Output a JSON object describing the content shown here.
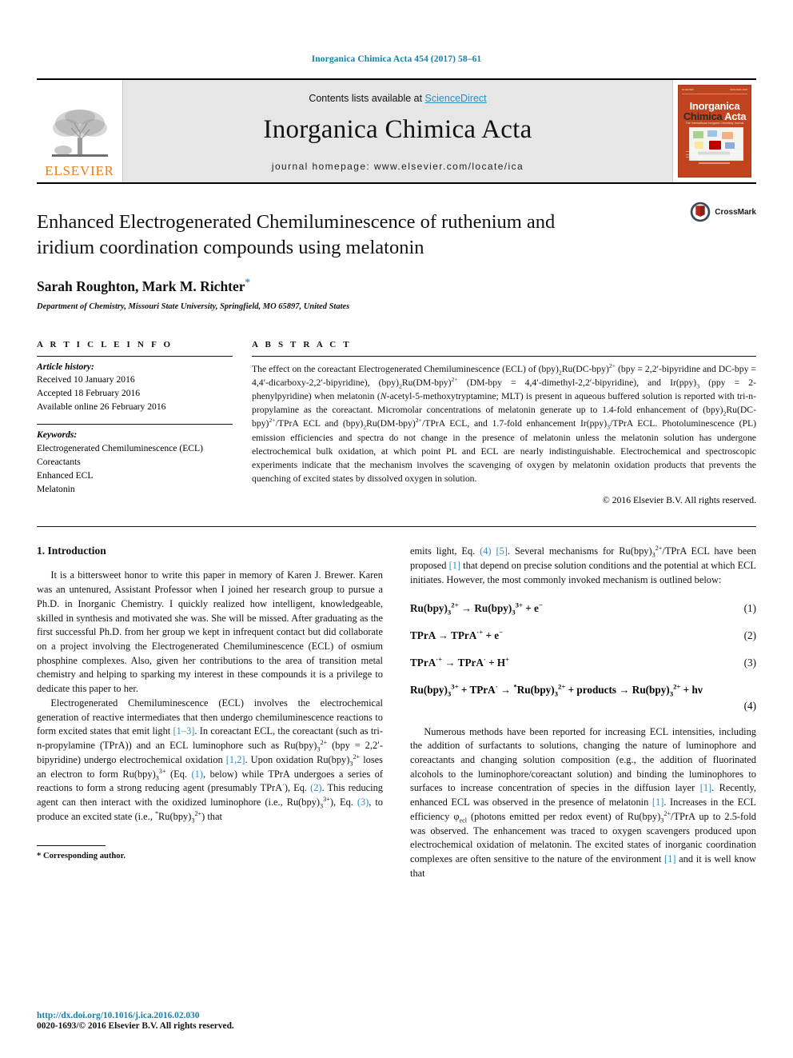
{
  "running_head": "Inorganica Chimica Acta 454 (2017) 58–61",
  "masthead": {
    "contents_prefix": "Contents lists available at ",
    "sciencedirect": "ScienceDirect",
    "journal_name": "Inorganica Chimica Acta",
    "homepage": "journal homepage: www.elsevier.com/locate/ica",
    "publisher_logo_text": "ELSEVIER",
    "cover": {
      "line1": "Inorganica",
      "line2a": "Chimica",
      "line2b": "Acta",
      "subtitle": "The International Inorganic Chemistry Journal"
    },
    "accent_link_color": "#2b8fc4",
    "elsevier_orange": "#ef7d12",
    "cover_red": "#c1441f"
  },
  "article": {
    "title": "Enhanced Electrogenerated Chemiluminescence of ruthenium and iridium coordination compounds using melatonin",
    "authors": "Sarah Roughton, Mark M. Richter",
    "author_star": "*",
    "affiliation": "Department of Chemistry, Missouri State University, Springfield, MO 65897, United States",
    "crossmark_label": "CrossMark"
  },
  "article_info": {
    "heading": "A R T I C L E    I N F O",
    "history_label": "Article history:",
    "history": [
      "Received 10 January 2016",
      "Accepted 18 February 2016",
      "Available online 26 February 2016"
    ],
    "keywords_label": "Keywords:",
    "keywords": [
      "Electrogenerated Chemiluminescence (ECL)",
      "Coreactants",
      "Enhanced ECL",
      "Melatonin"
    ]
  },
  "abstract": {
    "heading": "A B S T R A C T",
    "copyright": "© 2016 Elsevier B.V. All rights reserved."
  },
  "intro": {
    "heading": "1. Introduction",
    "p1": "It is a bittersweet honor to write this paper in memory of Karen J. Brewer. Karen was an untenured, Assistant Professor when I joined her research group to pursue a Ph.D. in Inorganic Chemistry. I quickly realized how intelligent, knowledgeable, skilled in synthesis and motivated she was. She will be missed. After graduating as the first successful Ph.D. from her group we kept in infrequent contact but did collaborate on a project involving the Electrogenerated Chemiluminescence (ECL) of osmium phosphine complexes. Also, given her contributions to the area of transition metal chemistry and helping to sparking my interest in these compounds it is a privilege to dedicate this paper to her."
  },
  "equations": [
    {
      "num": "(1)"
    },
    {
      "num": "(2)"
    },
    {
      "num": "(3)"
    },
    {
      "num": "(4)"
    }
  ],
  "footnote": {
    "marker": "*",
    "text": "Corresponding author."
  },
  "page_footer": {
    "doi": "http://dx.doi.org/10.1016/j.ica.2016.02.030",
    "issn_line": "0020-1693/© 2016 Elsevier B.V. All rights reserved."
  }
}
